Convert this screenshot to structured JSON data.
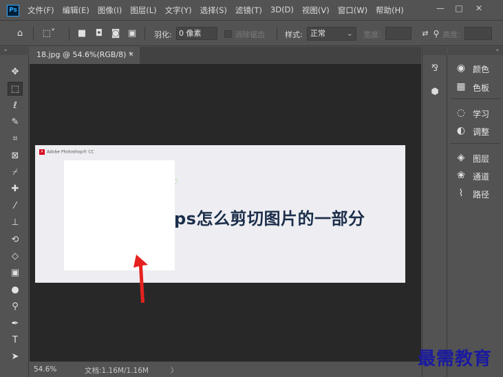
{
  "app": {
    "logo": "Ps"
  },
  "menu": {
    "items": [
      "文件(F)",
      "编辑(E)",
      "图像(I)",
      "图层(L)",
      "文字(Y)",
      "选择(S)",
      "滤镜(T)",
      "3D(D)",
      "视图(V)",
      "窗口(W)",
      "帮助(H)"
    ]
  },
  "window_controls": {
    "minimize": "—",
    "restore": "□",
    "close": "✕"
  },
  "options": {
    "feather_label": "羽化:",
    "feather_value": "0 像素",
    "antialias_label": "消除锯齿",
    "style_label": "样式:",
    "style_value": "正常",
    "width_label": "宽度:",
    "height_label": "高度:"
  },
  "document": {
    "tab_label": "18.jpg @ 54.6%(RGB/8) *",
    "tab_close": "×",
    "header_brand": "Adobe Photoshop® CC",
    "header_logo_letter": "A",
    "headline": "ps怎么剪切图片的一部分"
  },
  "status": {
    "zoom": "54.6%",
    "doc_size": "文档:1.16M/1.16M",
    "arrow": "〉"
  },
  "tools": [
    {
      "name": "move-tool",
      "icon": "✥"
    },
    {
      "name": "marquee-tool",
      "icon": "⬚"
    },
    {
      "name": "lasso-tool",
      "icon": "ℓ"
    },
    {
      "name": "quick-selection-tool",
      "icon": "✎"
    },
    {
      "name": "crop-tool",
      "icon": "⌗"
    },
    {
      "name": "frame-tool",
      "icon": "⊠"
    },
    {
      "name": "eyedropper-tool",
      "icon": "⌿"
    },
    {
      "name": "healing-brush-tool",
      "icon": "✚"
    },
    {
      "name": "brush-tool",
      "icon": "⁄"
    },
    {
      "name": "clone-stamp-tool",
      "icon": "⊥"
    },
    {
      "name": "history-brush-tool",
      "icon": "⟲"
    },
    {
      "name": "eraser-tool",
      "icon": "◇"
    },
    {
      "name": "gradient-tool",
      "icon": "▣"
    },
    {
      "name": "blur-tool",
      "icon": "●"
    },
    {
      "name": "dodge-tool",
      "icon": "⚲"
    },
    {
      "name": "pen-tool",
      "icon": "✒"
    },
    {
      "name": "type-tool",
      "icon": "T"
    },
    {
      "name": "path-selection-tool",
      "icon": "➤"
    }
  ],
  "panels": [
    {
      "name": "color",
      "label": "颜色",
      "icon": "◉"
    },
    {
      "name": "swatches",
      "label": "色板",
      "icon": "▦"
    },
    {
      "name": "learn",
      "label": "学习",
      "icon": "◌"
    },
    {
      "name": "adjustments",
      "label": "调整",
      "icon": "◐"
    },
    {
      "name": "layers",
      "label": "图层",
      "icon": "◈"
    },
    {
      "name": "channels",
      "label": "通道",
      "icon": "❀"
    },
    {
      "name": "paths",
      "label": "路径",
      "icon": "⌇"
    }
  ],
  "watermark": "最需教育"
}
